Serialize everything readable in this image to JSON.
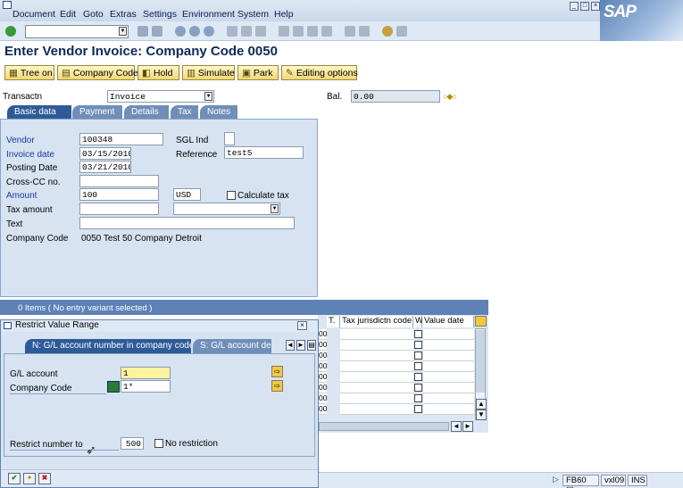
{
  "menu": [
    "Document",
    "Edit",
    "Goto",
    "Extras",
    "Settings",
    "Environment",
    "System",
    "Help"
  ],
  "brand": "SAP",
  "title": "Enter Vendor Invoice: Company Code 0050",
  "app_buttons": [
    "Tree on",
    "Company Code",
    "Hold",
    "Simulate",
    "Park",
    "Editing options"
  ],
  "header": {
    "transactn_label": "Transactn",
    "transactn_value": "Invoice",
    "bal_label": "Bal.",
    "bal_value": "0.00"
  },
  "tabs": [
    "Basic data",
    "Payment",
    "Details",
    "Tax",
    "Notes"
  ],
  "basic": {
    "vendor_label": "Vendor",
    "vendor_value": "100348",
    "sgl_label": "SGL Ind",
    "sgl_value": "",
    "invoice_date_label": "Invoice date",
    "invoice_date_value": "03/15/2010",
    "reference_label": "Reference",
    "reference_value": "test5",
    "posting_date_label": "Posting Date",
    "posting_date_value": "03/21/2010",
    "crosscc_label": "Cross-CC no.",
    "crosscc_value": "",
    "amount_label": "Amount",
    "amount_value": "100",
    "currency_value": "USD",
    "calc_tax_label": "Calculate tax",
    "tax_amount_label": "Tax amount",
    "tax_amount_value": "",
    "text_label": "Text",
    "text_value": "",
    "company_code_label": "Company Code",
    "company_code_value": "0050 Test 50 Company Detroit"
  },
  "grid": {
    "header": "0 Items ( No entry variant selected )",
    "col_t": "T.",
    "col_tax_juris": "Tax jurisdictn code",
    "col_w": "W",
    "col_value_date": "Value date",
    "row_fragment": "00"
  },
  "dialog": {
    "title": "Restrict Value Range",
    "tab1": "N: G/L account number in company code",
    "tab2": "S: G/L account de",
    "gl_label": "G/L account",
    "gl_value": "1",
    "cc_label": "Company Code",
    "cc_value": "1*",
    "restrict_label": "Restrict number to",
    "restrict_value": "500",
    "no_restriction_label": "No restriction"
  },
  "status": {
    "tcode": "FB60",
    "server": "vxl09",
    "mode": "INS"
  },
  "colors": {
    "tab_active": "#2f5a98",
    "button_fill": "#f1d875",
    "panel": "#d7e3f1",
    "highlight_field": "#fff3a0"
  }
}
